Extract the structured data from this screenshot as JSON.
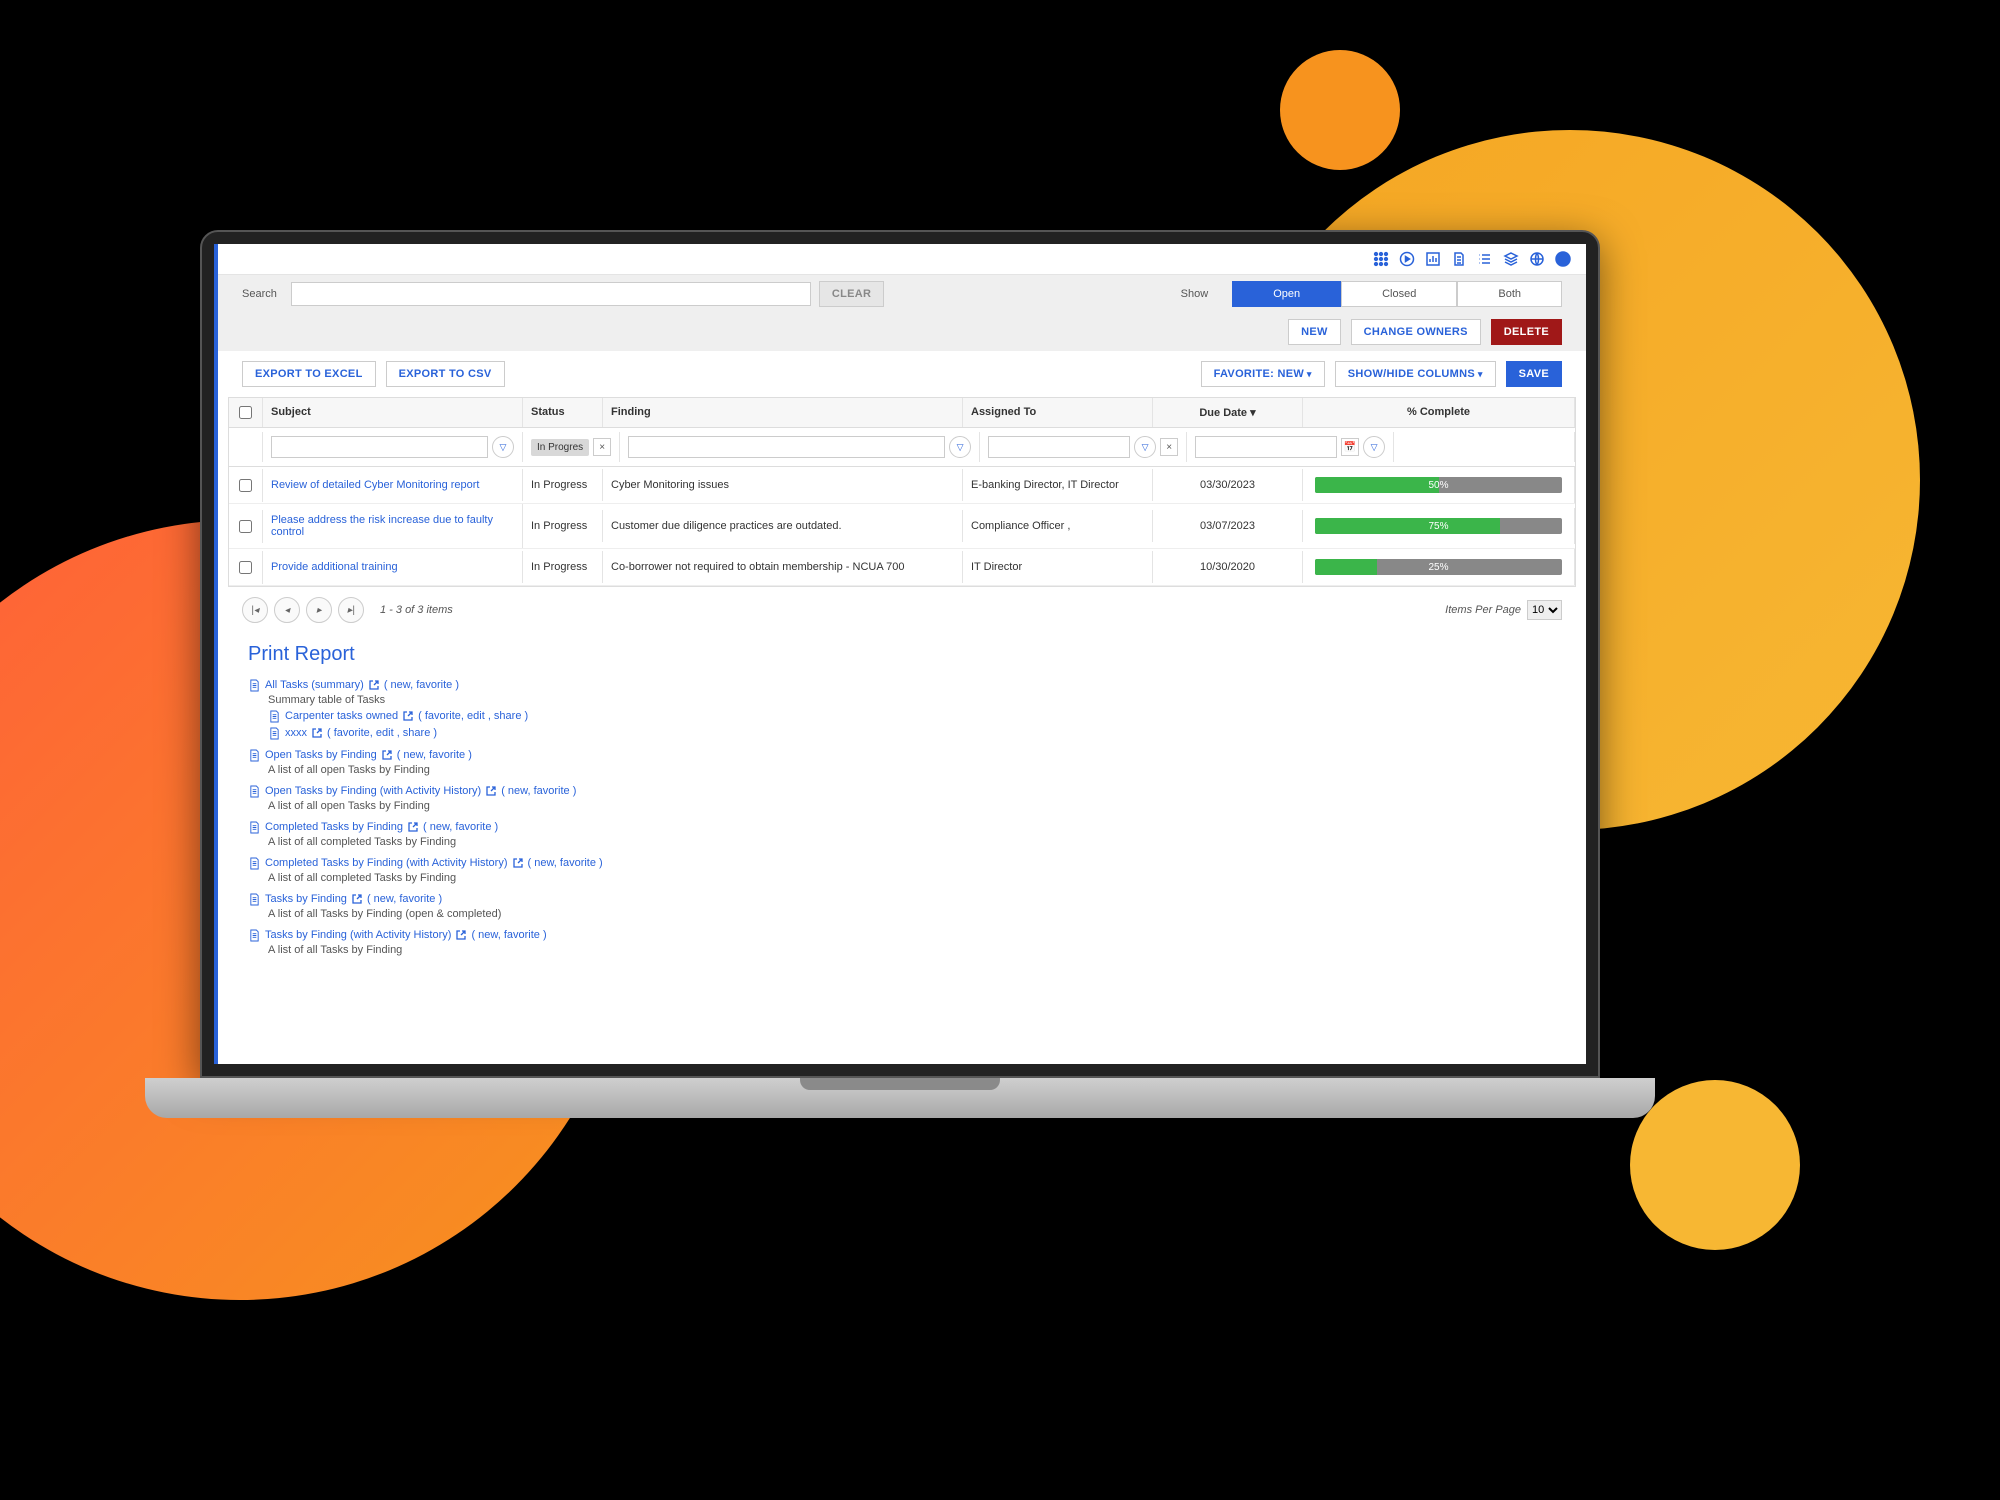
{
  "search": {
    "label": "Search",
    "clear": "Clear"
  },
  "show": {
    "label": "Show",
    "options": [
      "Open",
      "Closed",
      "Both"
    ],
    "active": "Open"
  },
  "actions": {
    "new": "NEW",
    "change_owners": "CHANGE OWNERS",
    "delete": "DELETE"
  },
  "toolbar": {
    "export_excel": "EXPORT TO EXCEL",
    "export_csv": "EXPORT TO CSV",
    "favorite": "FAVORITE: NEW",
    "show_hide": "SHOW/HIDE COLUMNS",
    "save": "SAVE"
  },
  "grid": {
    "headers": {
      "subject": "Subject",
      "status": "Status",
      "finding": "Finding",
      "assigned": "Assigned To",
      "due": "Due Date ▾",
      "pct": "% Complete"
    },
    "filter": {
      "status_chip": "In Progres"
    },
    "rows": [
      {
        "subject": "Review of detailed Cyber Monitoring report",
        "status": "In Progress",
        "finding": "Cyber Monitoring issues",
        "assigned": "E-banking Director, IT Director",
        "due": "03/30/2023",
        "pct": 50
      },
      {
        "subject": "Please address the risk increase due to faulty control",
        "status": "In Progress",
        "finding": "Customer due diligence practices are outdated.",
        "assigned": "Compliance Officer ,",
        "due": "03/07/2023",
        "pct": 75
      },
      {
        "subject": "Provide additional training",
        "status": "In Progress",
        "finding": "Co-borrower not required to obtain membership - NCUA 700",
        "assigned": "IT Director",
        "due": "10/30/2020",
        "pct": 25
      }
    ]
  },
  "pager": {
    "range": "1 - 3 of 3 items",
    "ipp_label": "Items Per Page",
    "ipp": "10"
  },
  "print": {
    "title": "Print Report",
    "nf": "( new, favorite )",
    "fes": "( favorite, edit , share )",
    "items": [
      {
        "title": "All Tasks (summary)",
        "desc": "Summary table of Tasks",
        "subs": [
          {
            "title": "Carpenter tasks owned"
          },
          {
            "title": "xxxx"
          }
        ]
      },
      {
        "title": "Open Tasks by Finding",
        "desc": "A list of all open Tasks by Finding"
      },
      {
        "title": "Open Tasks by Finding (with Activity History)",
        "desc": "A list of all open Tasks by Finding"
      },
      {
        "title": "Completed Tasks by Finding",
        "desc": "A list of all completed Tasks by Finding"
      },
      {
        "title": "Completed Tasks by Finding (with Activity History)",
        "desc": "A list of all completed Tasks by Finding"
      },
      {
        "title": "Tasks by Finding",
        "desc": "A list of all Tasks by Finding (open & completed)"
      },
      {
        "title": "Tasks by Finding (with Activity History)",
        "desc": "A list of all Tasks by Finding"
      }
    ]
  }
}
